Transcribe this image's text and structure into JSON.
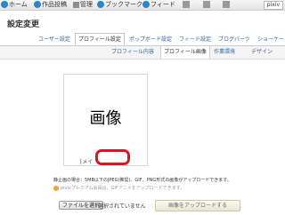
{
  "topnav": {
    "items": [
      "ホーム",
      "作品投稿",
      "管理",
      "ブックマーク",
      "フィード"
    ],
    "user_label": "pixiv"
  },
  "page": {
    "title": "設定変更"
  },
  "tabs": [
    "ユーザー設定",
    "プロフィール設定",
    "ポップボード設定",
    "フィード設定",
    "ブログパーツ",
    "ショーケー"
  ],
  "active_tab": "プロフィール設定",
  "subtabs": [
    "プロフィール内容",
    "プロフィール画像",
    "作業環境",
    "デザイン"
  ],
  "active_subtab": "プロフィール画像",
  "image": {
    "placeholder": "画像",
    "caption": "[メイ"
  },
  "notes": {
    "line1": "静止画の場合：5MB以下のJPEG(推奨)、GIF、PNG形式の画像がアップロードできます。",
    "line2": "pixivプレミアム会員は、GIFアニメをアップロードできます。"
  },
  "file": {
    "choose_label": "ファイルを選択",
    "status": "選択されていません"
  },
  "upload_label": "画像をアップロードする",
  "colors": {
    "link": "#2a6aa5",
    "highlight": "#e0141e",
    "nav_icon": "#2a86c9"
  }
}
